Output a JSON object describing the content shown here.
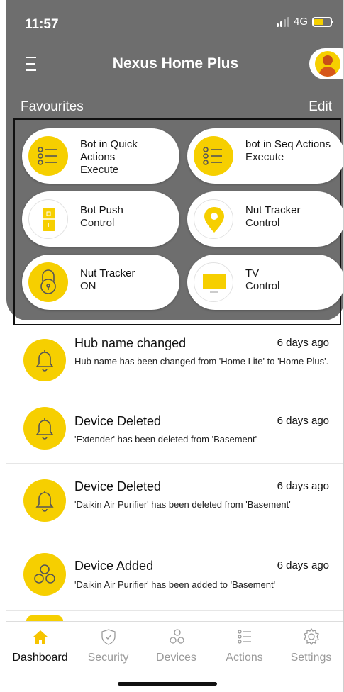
{
  "status_bar": {
    "time": "11:57",
    "network": "4G"
  },
  "header": {
    "title": "Nexus Home Plus",
    "favourites_label": "Favourites",
    "edit_label": "Edit"
  },
  "favourites": [
    {
      "name": "Bot in Quick Actions",
      "status": "Execute",
      "icon": "actions-list-icon"
    },
    {
      "name": "bot in Seq Actions",
      "status": "Execute",
      "icon": "actions-list-icon"
    },
    {
      "name": "Bot Push",
      "status": "Control",
      "icon": "bot-push-icon"
    },
    {
      "name": "Nut Tracker",
      "status": "Control",
      "icon": "location-pin-icon"
    },
    {
      "name": "Nut Tracker",
      "status": "ON",
      "icon": "lock-icon"
    },
    {
      "name": "TV",
      "status": "Control",
      "icon": "tv-icon"
    }
  ],
  "notifications": [
    {
      "title": "Hub name changed",
      "time": "6 days ago",
      "message": "Hub name has been changed from 'Home Lite' to 'Home Plus'.",
      "icon": "bell-icon"
    },
    {
      "title": "Device Deleted",
      "time": "6 days ago",
      "message": "'Extender' has been deleted from 'Basement'",
      "icon": "bell-icon"
    },
    {
      "title": "Device Deleted",
      "time": "6 days ago",
      "message": "'Daikin Air Purifier' has been deleted from 'Basement'",
      "icon": "bell-icon"
    },
    {
      "title": "Device Added",
      "time": "6 days ago",
      "message": "'Daikin Air Purifier' has been added to 'Basement'",
      "icon": "devices-icon"
    }
  ],
  "tabs": [
    {
      "label": "Dashboard",
      "icon": "home-icon",
      "active": true
    },
    {
      "label": "Security",
      "icon": "shield-icon",
      "active": false
    },
    {
      "label": "Devices",
      "icon": "devices-icon",
      "active": false
    },
    {
      "label": "Actions",
      "icon": "actions-list-icon",
      "active": false
    },
    {
      "label": "Settings",
      "icon": "gear-icon",
      "active": false
    }
  ],
  "colors": {
    "accent": "#f6cf00",
    "header_bg": "#6e6e6e"
  }
}
